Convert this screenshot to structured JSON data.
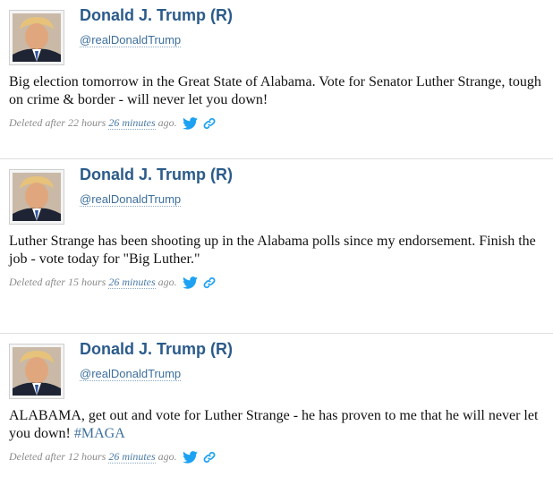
{
  "tweets": [
    {
      "author_name": "Donald J. Trump (R)",
      "handle": "@realDonaldTrump",
      "text": "Big election tomorrow in the Great State of Alabama. Vote for Senator Luther Strange, tough on crime & border - will never let you down!",
      "hashtag": "",
      "deleted_prefix": "Deleted after 22 hours",
      "minutes_link": "26 minutes",
      "deleted_suffix": "ago."
    },
    {
      "author_name": "Donald J. Trump (R)",
      "handle": "@realDonaldTrump",
      "text": "Luther Strange has been shooting up in the Alabama polls since my endorsement. Finish the job - vote today for \"Big Luther.\"",
      "hashtag": "",
      "deleted_prefix": "Deleted after 15 hours",
      "minutes_link": "26 minutes",
      "deleted_suffix": "ago."
    },
    {
      "author_name": "Donald J. Trump (R)",
      "handle": "@realDonaldTrump",
      "text": "ALABAMA, get out and vote for Luther Strange - he has proven to me that he will never let you down!",
      "hashtag": "#MAGA",
      "deleted_prefix": "Deleted after 12 hours",
      "minutes_link": "26 minutes",
      "deleted_suffix": "ago."
    }
  ],
  "icons": {
    "twitter": "twitter-bird-icon",
    "link": "link-chain-icon"
  },
  "colors": {
    "name": "#2b5b8a",
    "link": "#3d6f9c",
    "twitter_blue": "#1da1f2",
    "meta_text": "#8a8a8a"
  }
}
